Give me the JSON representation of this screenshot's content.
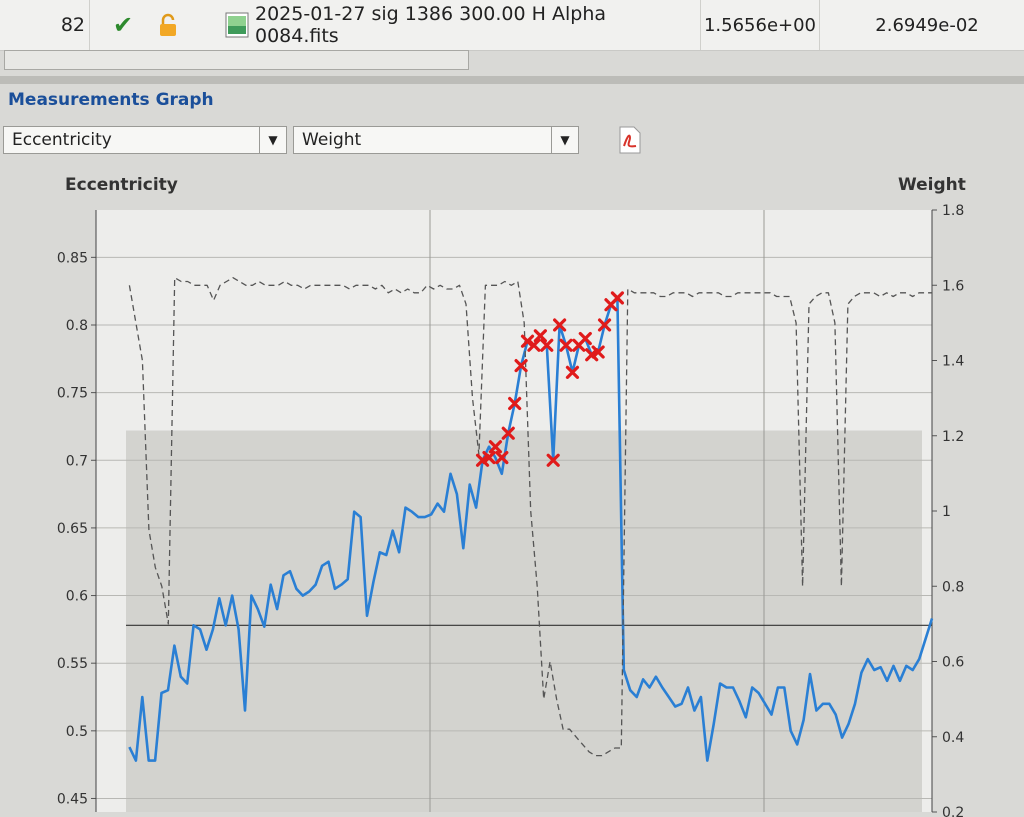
{
  "table_row": {
    "index": "82",
    "filename": "2025-01-27 sig 1386 300.00 H Alpha 0084.fits",
    "value1": "1.5656e+00",
    "value2": "2.6949e-02",
    "status_icon": "check-icon",
    "lock_icon": "lock-open-icon",
    "file_icon": "image-file-icon",
    "status_color": "#2d8a2d"
  },
  "panel": {
    "title": "Measurements Graph"
  },
  "controls": {
    "left_measure": "Eccentricity",
    "right_measure": "Weight",
    "export_icon": "pdf-export-icon"
  },
  "chart_data": {
    "type": "line",
    "ylabel": "Eccentricity",
    "y2label": "Weight",
    "ylim": [
      0.44,
      0.885
    ],
    "y2lim": [
      0.2,
      1.8
    ],
    "yticks": [
      "0.85",
      "0.8",
      "0.75",
      "0.7",
      "0.65",
      "0.6",
      "0.55",
      "0.5",
      "0.45"
    ],
    "y2ticks": [
      "1.8",
      "1.6",
      "1.4",
      "1.2",
      "1",
      "0.8",
      "0.6",
      "0.4",
      "0.2"
    ],
    "xlim": [
      0,
      125
    ],
    "grid": true,
    "reference_line": 0.578,
    "series": [
      {
        "role": "eccentricity",
        "color": "#2a7fd4",
        "style": "solid",
        "values": [
          0.488,
          0.478,
          0.525,
          0.478,
          0.478,
          0.528,
          0.53,
          0.563,
          0.54,
          0.535,
          0.578,
          0.575,
          0.56,
          0.575,
          0.598,
          0.578,
          0.6,
          0.575,
          0.515,
          0.6,
          0.59,
          0.577,
          0.608,
          0.59,
          0.615,
          0.618,
          0.605,
          0.6,
          0.603,
          0.608,
          0.622,
          0.625,
          0.605,
          0.608,
          0.612,
          0.662,
          0.658,
          0.585,
          0.61,
          0.632,
          0.63,
          0.648,
          0.632,
          0.665,
          0.662,
          0.658,
          0.658,
          0.66,
          0.668,
          0.662,
          0.69,
          0.675,
          0.635,
          0.682,
          0.665,
          0.7,
          0.71,
          0.702,
          0.69,
          0.72,
          0.742,
          0.77,
          0.788,
          0.785,
          0.792,
          0.785,
          0.7,
          0.8,
          0.785,
          0.765,
          0.785,
          0.79,
          0.778,
          0.78,
          0.8,
          0.815,
          0.82,
          0.545,
          0.53,
          0.525,
          0.538,
          0.532,
          0.54,
          0.532,
          0.525,
          0.518,
          0.52,
          0.532,
          0.515,
          0.525,
          0.478,
          0.505,
          0.535,
          0.532,
          0.532,
          0.522,
          0.51,
          0.532,
          0.528,
          0.52,
          0.512,
          0.532,
          0.532,
          0.5,
          0.49,
          0.508,
          0.542,
          0.515,
          0.52,
          0.52,
          0.512,
          0.495,
          0.505,
          0.52,
          0.543,
          0.553,
          0.545,
          0.547,
          0.537,
          0.548,
          0.537,
          0.548,
          0.545,
          0.553,
          0.568,
          0.583
        ]
      },
      {
        "role": "weight",
        "color": "#555555",
        "style": "dashed",
        "values": [
          1.6,
          1.5,
          1.4,
          0.95,
          0.85,
          0.8,
          0.7,
          1.62,
          1.61,
          1.61,
          1.6,
          1.6,
          1.6,
          1.56,
          1.6,
          1.61,
          1.62,
          1.61,
          1.6,
          1.6,
          1.61,
          1.6,
          1.6,
          1.6,
          1.61,
          1.6,
          1.6,
          1.59,
          1.6,
          1.6,
          1.6,
          1.6,
          1.6,
          1.6,
          1.59,
          1.6,
          1.6,
          1.6,
          1.59,
          1.6,
          1.58,
          1.59,
          1.58,
          1.59,
          1.58,
          1.58,
          1.6,
          1.59,
          1.6,
          1.59,
          1.59,
          1.6,
          1.55,
          1.3,
          1.15,
          1.6,
          1.6,
          1.6,
          1.61,
          1.6,
          1.61,
          1.5,
          1.0,
          0.8,
          0.5,
          0.6,
          0.5,
          0.42,
          0.42,
          0.4,
          0.38,
          0.36,
          0.35,
          0.35,
          0.36,
          0.37,
          0.37,
          1.59,
          1.58,
          1.58,
          1.58,
          1.58,
          1.57,
          1.57,
          1.58,
          1.58,
          1.58,
          1.57,
          1.58,
          1.58,
          1.58,
          1.58,
          1.57,
          1.57,
          1.58,
          1.58,
          1.58,
          1.58,
          1.58,
          1.58,
          1.57,
          1.57,
          1.57,
          1.5,
          0.8,
          1.55,
          1.57,
          1.58,
          1.58,
          1.5,
          0.8,
          1.55,
          1.57,
          1.58,
          1.58,
          1.58,
          1.57,
          1.58,
          1.57,
          1.58,
          1.58,
          1.57,
          1.58,
          1.58,
          1.58
        ]
      }
    ],
    "flagged_points": [
      {
        "x": 55,
        "y": 0.7
      },
      {
        "x": 56,
        "y": 0.702
      },
      {
        "x": 57,
        "y": 0.71
      },
      {
        "x": 58,
        "y": 0.702
      },
      {
        "x": 59,
        "y": 0.72
      },
      {
        "x": 60,
        "y": 0.742
      },
      {
        "x": 61,
        "y": 0.77
      },
      {
        "x": 62,
        "y": 0.788
      },
      {
        "x": 63,
        "y": 0.785
      },
      {
        "x": 64,
        "y": 0.792
      },
      {
        "x": 65,
        "y": 0.785
      },
      {
        "x": 66,
        "y": 0.7
      },
      {
        "x": 67,
        "y": 0.8
      },
      {
        "x": 68,
        "y": 0.785
      },
      {
        "x": 69,
        "y": 0.765
      },
      {
        "x": 70,
        "y": 0.785
      },
      {
        "x": 71,
        "y": 0.79
      },
      {
        "x": 72,
        "y": 0.778
      },
      {
        "x": 73,
        "y": 0.78
      },
      {
        "x": 74,
        "y": 0.8
      },
      {
        "x": 75,
        "y": 0.815
      },
      {
        "x": 76,
        "y": 0.82
      }
    ],
    "flag_color": "#e01b1b",
    "shaded_bands": [
      {
        "y_from": 0.44,
        "y_to": 0.722,
        "color": "#c9c9c5"
      }
    ]
  }
}
